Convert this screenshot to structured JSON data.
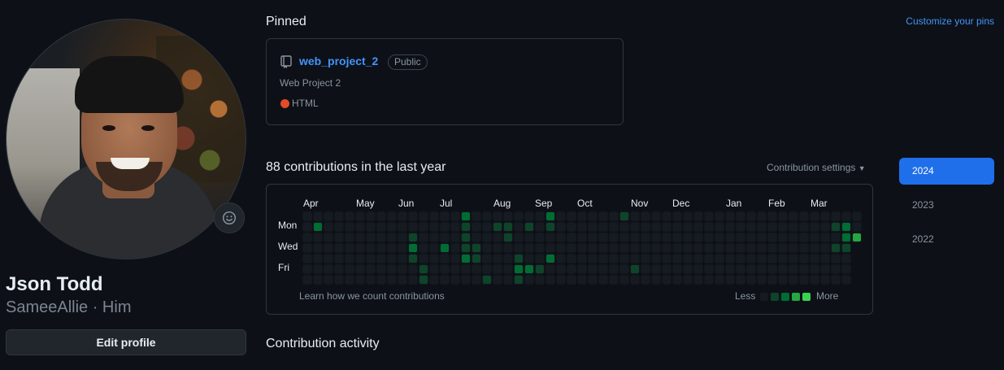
{
  "profile": {
    "display_name": "Json Todd",
    "handle_line": "SameeAllie · Him",
    "edit_profile_label": "Edit profile",
    "status_icon": "smiley-icon"
  },
  "pinned": {
    "title": "Pinned",
    "customize_label": "Customize your pins",
    "repos": [
      {
        "name": "web_project_2",
        "visibility": "Public",
        "description": "Web Project 2",
        "language": "HTML",
        "language_color": "#e34c26"
      }
    ]
  },
  "contributions": {
    "title": "88 contributions in the last year",
    "settings_label": "Contribution settings",
    "months": [
      "Apr",
      "May",
      "Jun",
      "Jul",
      "Aug",
      "Sep",
      "Oct",
      "Nov",
      "Dec",
      "Jan",
      "Feb",
      "Mar"
    ],
    "day_labels": [
      "Mon",
      "Wed",
      "Fri"
    ],
    "learn_label": "Learn how we count contributions",
    "legend_less": "Less",
    "legend_more": "More",
    "colors": [
      "#161b22",
      "#0e4429",
      "#006d32",
      "#26a641",
      "#39d353"
    ],
    "active_cells": [
      [
        1,
        1,
        2
      ],
      [
        15,
        4,
        2
      ],
      [
        16,
        3,
        1
      ],
      [
        10,
        2,
        1
      ],
      [
        10,
        3,
        2
      ],
      [
        10,
        4,
        1
      ],
      [
        11,
        5,
        1
      ],
      [
        11,
        6,
        1
      ],
      [
        13,
        3,
        2
      ],
      [
        15,
        0,
        2
      ],
      [
        15,
        1,
        1
      ],
      [
        15,
        2,
        1
      ],
      [
        15,
        3,
        1
      ],
      [
        16,
        4,
        1
      ],
      [
        17,
        6,
        1
      ],
      [
        18,
        1,
        1
      ],
      [
        19,
        2,
        1
      ],
      [
        20,
        4,
        1
      ],
      [
        20,
        5,
        2
      ],
      [
        20,
        6,
        1
      ],
      [
        21,
        1,
        1
      ],
      [
        21,
        5,
        2
      ],
      [
        22,
        5,
        1
      ],
      [
        23,
        0,
        2
      ],
      [
        23,
        1,
        1
      ],
      [
        23,
        4,
        2
      ],
      [
        30,
        0,
        1
      ],
      [
        31,
        5,
        1
      ],
      [
        50,
        1,
        1
      ],
      [
        50,
        3,
        1
      ],
      [
        51,
        1,
        2
      ],
      [
        51,
        2,
        2
      ],
      [
        51,
        3,
        1
      ],
      [
        52,
        2,
        3
      ],
      [
        53,
        2,
        4
      ],
      [
        19,
        1,
        1
      ]
    ]
  },
  "years": [
    "2024",
    "2023",
    "2022"
  ],
  "activity_title": "Contribution activity"
}
